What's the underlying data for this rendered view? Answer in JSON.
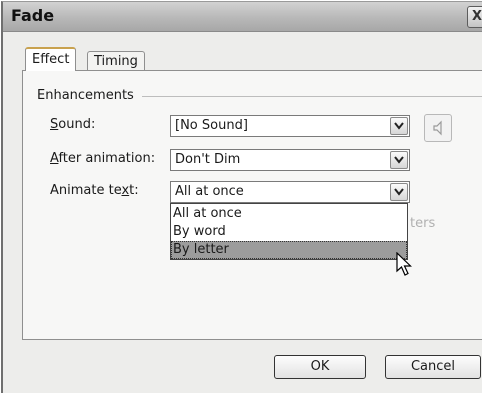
{
  "window": {
    "title": "Fade",
    "close_glyph": "X"
  },
  "tabs": [
    {
      "label": "Effect",
      "active": true
    },
    {
      "label": "Timing",
      "active": false
    }
  ],
  "group": {
    "label": "Enhancements"
  },
  "sound": {
    "label_prefix": "",
    "label_mnemonic": "S",
    "label_suffix": "ound:",
    "value": "[No Sound]",
    "icon": "speaker-icon"
  },
  "after_animation": {
    "label_mnemonic": "A",
    "label_suffix": "fter animation:",
    "value": "Don't Dim"
  },
  "animate_text": {
    "label_prefix": "Animate te",
    "label_mnemonic": "x",
    "label_suffix": "t:",
    "value": "All at once"
  },
  "animate_text_options": [
    "All at once",
    "By word",
    "By letter"
  ],
  "selected_option_index": 2,
  "obscured_text": "ters",
  "buttons": {
    "ok": "OK",
    "cancel": "Cancel"
  }
}
